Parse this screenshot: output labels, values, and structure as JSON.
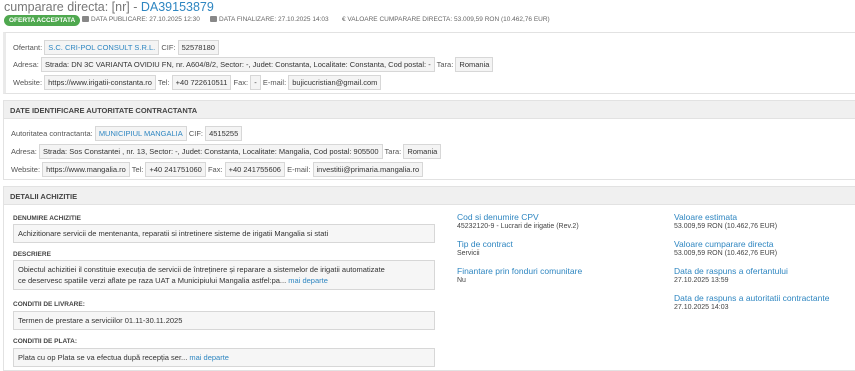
{
  "header": {
    "title_prefix": "cumparare directa: [nr] - ",
    "title_code": "DA39153879",
    "badge": "OFERTA ACCEPTATA",
    "publish": "DATA PUBLICARE: 27.10.2025 12:30",
    "finalize": "DATA FINALIZARE: 27.10.2025 14:03",
    "value": "€ VALOARE CUMPARARE DIRECTA: 53.009,59 RON (10.462,76 EUR)"
  },
  "ofertant": {
    "label": "Ofertant:",
    "name": "S.C. CRI-POL CONSULT S.R.L.",
    "cif_label": "CIF:",
    "cif": "52578180",
    "address_label": "Adresa:",
    "address": "Strada: DN 3C VARIANTA OVIDIU FN, nr. A604/8/2, Sector: -, Judet: Constanta, Localitate: Constanta, Cod postal: -",
    "country_label": "Tara:",
    "country": "Romania",
    "website_label": "Website:",
    "website": "https://www.irigatii-constanta.ro",
    "tel_label": "Tel:",
    "tel": "+40 722610511",
    "fax_label": "Fax:",
    "fax": "-",
    "email_label": "E-mail:",
    "email": "bujicucristian@gmail.com"
  },
  "autoritate": {
    "heading": "DATE IDENTIFICARE AUTORITATE CONTRACTANTA",
    "label": "Autoritatea contractanta:",
    "name": "MUNICIPIUL MANGALIA",
    "cif_label": "CIF:",
    "cif": "4515255",
    "address_label": "Adresa:",
    "address": "Strada: Sos Constantei , nr. 13, Sector: -, Judet: Constanta, Localitate: Mangalia, Cod postal: 905500",
    "country_label": "Tara:",
    "country": "Romania",
    "website_label": "Website:",
    "website": "https://www.mangalia.ro",
    "tel_label": "Tel:",
    "tel": "+40 241751060",
    "fax_label": "Fax:",
    "fax": "+40 241755606",
    "email_label": "E-mail:",
    "email": "investitii@primaria.mangalia.ro"
  },
  "achizitie": {
    "heading": "DETALII ACHIZITIE",
    "denumire_label": "DENUMIRE ACHIZITIE",
    "denumire": "Achizitionare servicii de mentenanta, reparatii si intretinere sisteme de irigatii Mangalia si stati",
    "descriere_label": "DESCRIERE",
    "descriere_line1": "Obiectul achizitiei il constituie execuția de servicii de întreținere și reparare a sistemelor de irigatii automatizate",
    "descriere_line2": "ce deservesc spatiile verzi aflate pe raza UAT a Municipiului Mangalia astfel:pa...",
    "more": "mai departe",
    "livrare_label": "CONDITII DE LIVRARE:",
    "livrare": "Termen de prestare a serviciilor 01.11-30.11.2025",
    "plata_label": "CONDITII DE PLATA:",
    "plata": "Plata cu op Plata se va efectua după recepția ser...",
    "cpv_title": "Cod si denumire CPV",
    "cpv": "45232120-9 - Lucrari de irigatie (Rev.2)",
    "tip_title": "Tip de contract",
    "tip": "Servicii",
    "fin_title": "Finantare prin fonduri comunitare",
    "fin": "Nu",
    "est_title": "Valoare estimata",
    "est": "53.009,59  RON (10.462,76  EUR)",
    "cd_title": "Valoare cumparare directa",
    "cd": "53.009,59  RON (10.462,76  EUR)",
    "rasp_of_title": "Data de raspuns a ofertantului",
    "rasp_of": "27.10.2025 13:59",
    "rasp_ac_title": "Data de raspuns a autoritatii contractante",
    "rasp_ac": "27.10.2025 14:03"
  }
}
